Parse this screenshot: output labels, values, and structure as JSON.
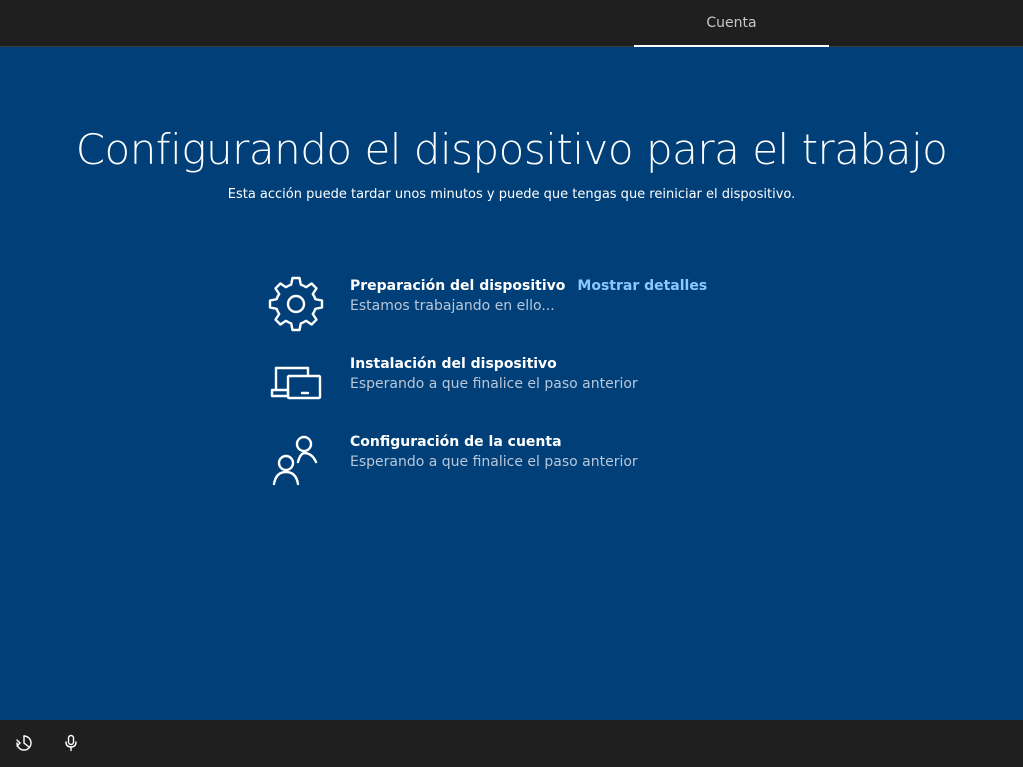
{
  "topbar": {
    "tabs": [
      {
        "label": "Cuenta",
        "active": true
      }
    ]
  },
  "main": {
    "title": "Configurando el dispositivo para el trabajo",
    "subtitle": "Esta acción puede tardar unos minutos y puede que tengas que reiniciar el dispositivo.",
    "steps": [
      {
        "icon": "gear-icon",
        "title": "Preparación del dispositivo",
        "link": "Mostrar detalles",
        "status": "Estamos trabajando en ello..."
      },
      {
        "icon": "device-setup-icon",
        "title": "Instalación del dispositivo",
        "status": "Esperando a que finalice el paso anterior"
      },
      {
        "icon": "people-icon",
        "title": "Configuración de la cuenta",
        "status": "Esperando a que finalice el paso anterior"
      }
    ]
  },
  "bottombar": {
    "icons": [
      "ease-of-access-icon",
      "microphone-icon"
    ]
  },
  "colors": {
    "background": "#003f77",
    "bar": "#1f1f1f",
    "link": "#8cc8ff",
    "status_text": "#b9c7da"
  }
}
